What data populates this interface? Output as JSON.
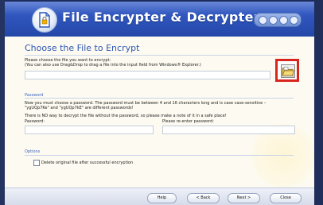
{
  "app": {
    "title": "File Encrypter & Decrypter"
  },
  "step": {
    "title": "Choose the File to Encrypt"
  },
  "file": {
    "label": "Please choose the file you want to encrypt:",
    "hint": "(You can also use Drag&Drop to drag a file into the input field from Windows® Explorer.)",
    "value": ""
  },
  "password": {
    "section": "Password",
    "info_line1": "Now you must choose a password. The password must be between 4 and 16 characters long and is case case-sensitive –",
    "info_line2": "\"ygUQp7Ke\" and \"ygUQp7kE\" are different passwords!",
    "warn": "There is NO way to decrypt the file without the password, so please make a note of it in a safe place!",
    "label": "Password:",
    "reenter_label": "Please re-enter password:",
    "value": "",
    "reenter_value": ""
  },
  "options": {
    "section": "Options",
    "delete_label": "Delete original file after successful encryption",
    "delete_checked": false
  },
  "footer": {
    "help": "Help",
    "back": "< Back",
    "next": "Next >",
    "close": "Close"
  },
  "colors": {
    "header": "#2f55bd",
    "accent": "#3a63bf",
    "highlight": "#d8261f"
  }
}
